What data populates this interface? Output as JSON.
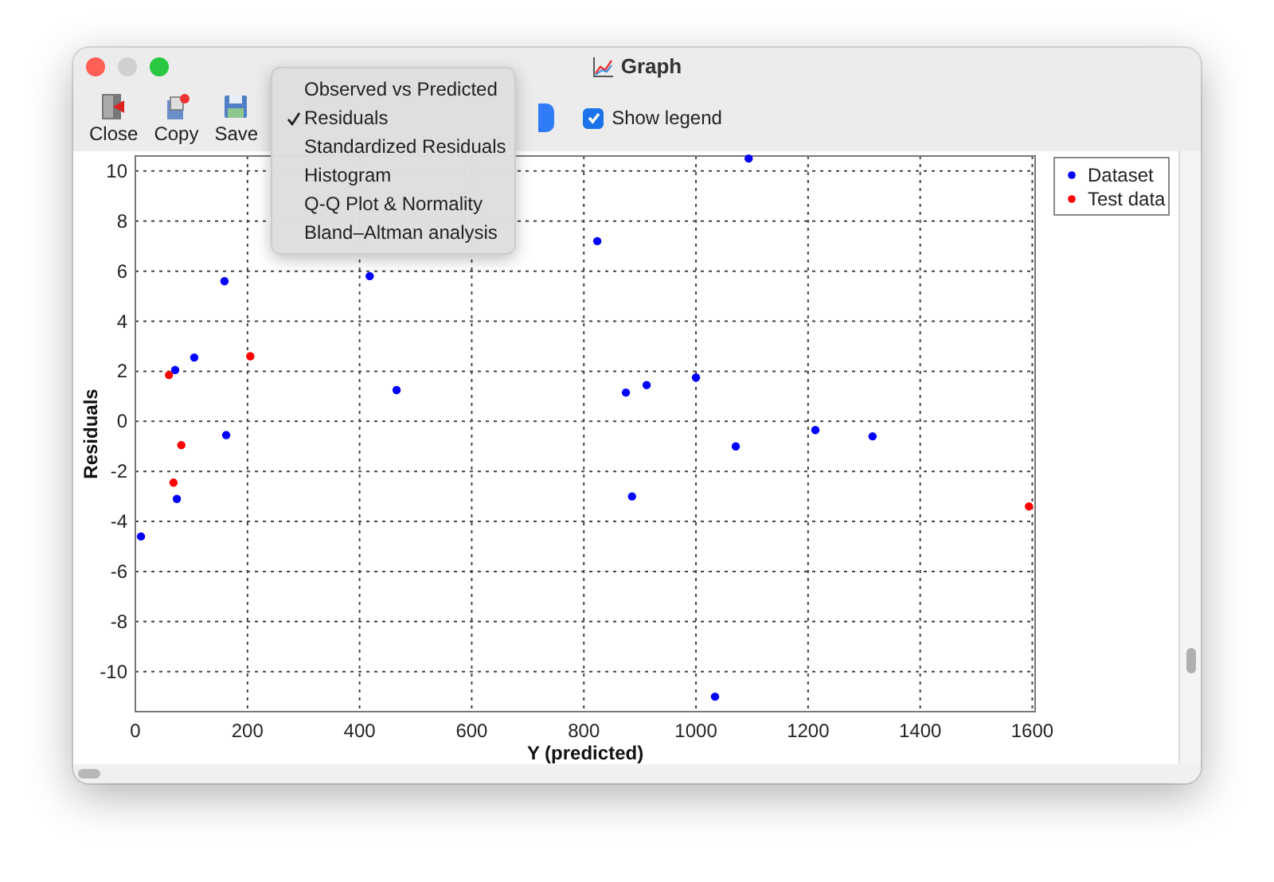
{
  "window": {
    "title": "Graph"
  },
  "toolbar": {
    "buttons": [
      {
        "label": "Close",
        "kind": "close"
      },
      {
        "label": "Copy",
        "kind": "copy"
      },
      {
        "label": "Save",
        "kind": "save"
      }
    ],
    "show_legend": {
      "label": "Show legend",
      "checked": true
    }
  },
  "menu": {
    "items": [
      {
        "label": "Observed vs Predicted",
        "selected": false
      },
      {
        "label": "Residuals",
        "selected": true
      },
      {
        "label": "Standardized Residuals",
        "selected": false
      },
      {
        "label": "Histogram",
        "selected": false
      },
      {
        "label": "Q-Q Plot & Normality",
        "selected": false
      },
      {
        "label": "Bland–Altman analysis",
        "selected": false
      }
    ]
  },
  "chart_data": {
    "type": "scatter",
    "grid": true,
    "legend": true,
    "xlabel": "Y (predicted)",
    "ylabel": "Residuals",
    "xlim": [
      0,
      1605
    ],
    "ylim": [
      -11.6,
      10.6
    ],
    "xticks": [
      0,
      200,
      400,
      600,
      800,
      1000,
      1200,
      1400,
      1600
    ],
    "yticks": [
      -10,
      -8,
      -6,
      -4,
      -2,
      0,
      2,
      4,
      6,
      8,
      10
    ],
    "series": [
      {
        "name": "Dataset",
        "color": "#0000ff",
        "x": [
          10,
          71,
          74,
          105,
          159,
          162,
          418,
          466,
          824,
          875,
          886,
          912,
          1000,
          1034,
          1071,
          1094,
          1213,
          1315
        ],
        "values": [
          -4.6,
          2.05,
          -3.1,
          2.55,
          5.6,
          -0.55,
          5.8,
          1.25,
          7.2,
          1.15,
          -3.0,
          1.45,
          1.75,
          -11.0,
          -1.0,
          10.5,
          -0.35,
          -0.6
        ]
      },
      {
        "name": "Test data",
        "color": "#ff0000",
        "x": [
          60,
          68,
          82,
          205,
          1594
        ],
        "values": [
          1.85,
          -2.45,
          -0.95,
          2.6,
          -3.4
        ]
      }
    ]
  }
}
